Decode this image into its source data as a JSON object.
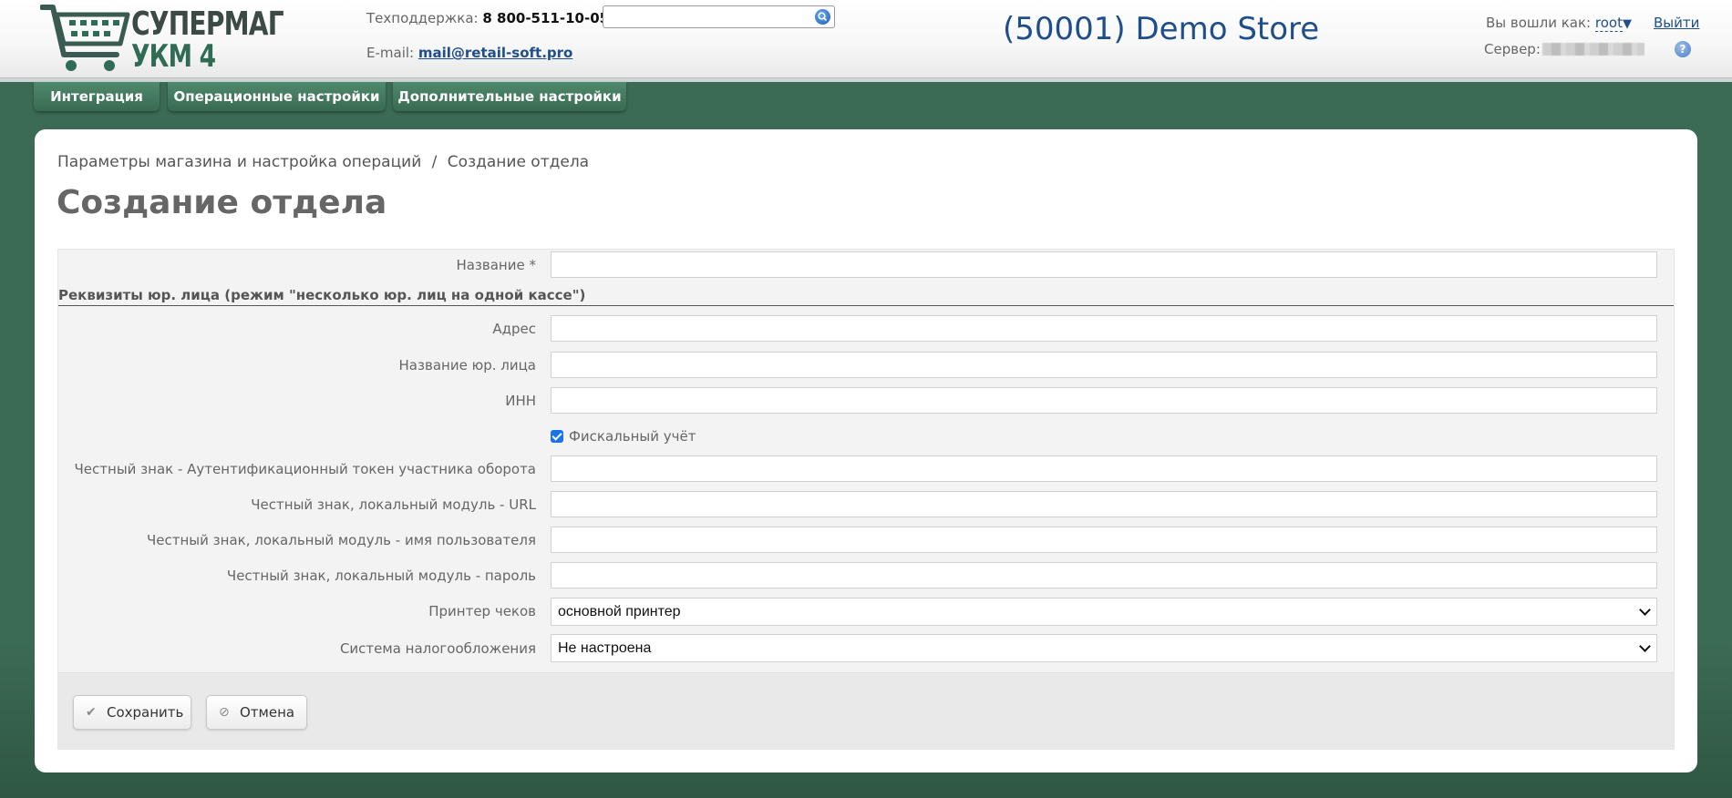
{
  "header": {
    "logo_line1": "СУПЕРМАГ",
    "logo_line2": "УКМ 4",
    "support_label": "Техподдержка:",
    "support_phone": "8 800-511-10-05",
    "email_label": "E-mail:",
    "email": "mail@retail-soft.pro",
    "search_placeholder": "",
    "store_title": "(50001) Demo Store",
    "login_label": "Вы вошли как:",
    "login_user": "root",
    "logout": "Выйти",
    "server_label": "Сервер:"
  },
  "tabs": [
    {
      "label": "Интеграция"
    },
    {
      "label": "Операционные настройки"
    },
    {
      "label": "Дополнительные настройки"
    }
  ],
  "breadcrumb": {
    "parent": "Параметры магазина и настройка операций",
    "separator": "/",
    "current": "Создание отдела"
  },
  "page_title": "Создание отдела",
  "form": {
    "name_label": "Название *",
    "name_value": "",
    "section_title": "Реквизиты юр. лица (режим \"несколько юр. лиц на одной кассе\")",
    "address_label": "Адрес",
    "legal_name_label": "Название юр. лица",
    "inn_label": "ИНН",
    "fiscal_label": "Фискальный учёт",
    "fiscal_checked": true,
    "token_label": "Честный знак - Аутентификационный токен участника оборота",
    "url_label": "Честный знак, локальный модуль - URL",
    "username_label": "Честный знак, локальный модуль - имя пользователя",
    "password_label": "Честный знак, локальный модуль - пароль",
    "printer_label": "Принтер чеков",
    "printer_value": "основной принтер",
    "tax_label": "Система налогообложения",
    "tax_value": "Не настроена"
  },
  "actions": {
    "save": "Сохранить",
    "cancel": "Отмена"
  },
  "icons": {
    "search": "search-icon",
    "help": "help-icon",
    "save": "check-icon",
    "cancel": "cancel-icon"
  },
  "colors": {
    "background": "#3c6b55",
    "tab": "#396a52",
    "link": "#1f4f8b"
  }
}
